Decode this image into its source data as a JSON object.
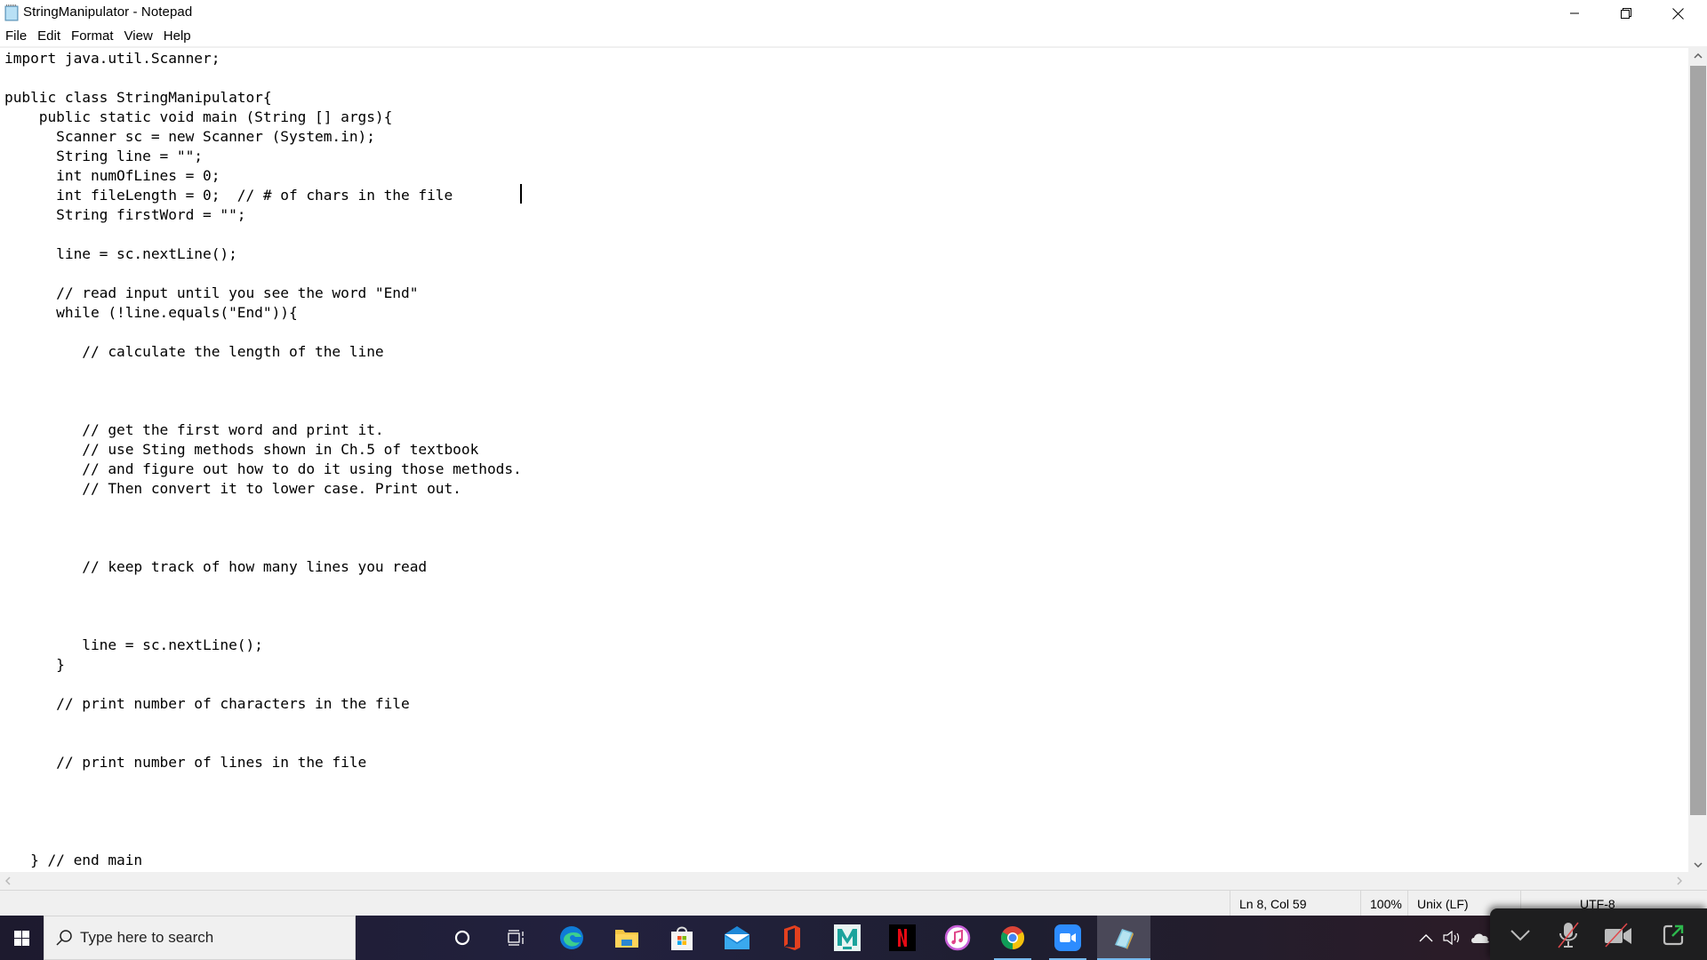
{
  "window": {
    "title": "StringManipulator - Notepad",
    "app_icon": "notepad-icon",
    "controls": {
      "minimize": "minimize-icon",
      "maximize": "restore-icon",
      "close": "close-icon"
    }
  },
  "menu": {
    "items": [
      {
        "label": "File"
      },
      {
        "label": "Edit"
      },
      {
        "label": "Format"
      },
      {
        "label": "View"
      },
      {
        "label": "Help"
      }
    ]
  },
  "editor": {
    "lines": [
      "import java.util.Scanner;",
      "",
      "public class StringManipulator{",
      "    public static void main (String [] args){",
      "      Scanner sc = new Scanner (System.in);",
      "      String line = \"\";",
      "      int numOfLines = 0;",
      "      int fileLength = 0;  // # of chars in the file      ",
      "      String firstWord = \"\";",
      "",
      "      line = sc.nextLine();",
      "",
      "      // read input until you see the word \"End\"",
      "      while (!line.equals(\"End\")){",
      "",
      "         // calculate the length of the line",
      "",
      "",
      "",
      "         // get the first word and print it.",
      "         // use Sting methods shown in Ch.5 of textbook",
      "         // and figure out how to do it using those methods.",
      "         // Then convert it to lower case. Print out.",
      "",
      "",
      "",
      "         // keep track of how many lines you read",
      "",
      "",
      "",
      "         line = sc.nextLine();",
      "      }",
      "",
      "      // print number of characters in the file",
      "",
      "",
      "      // print number of lines in the file",
      "",
      "",
      "",
      "",
      "   } // end main"
    ]
  },
  "status": {
    "position": "Ln 8, Col 59",
    "zoom": "100%",
    "line_ending": "Unix (LF)",
    "encoding": "UTF-8"
  },
  "taskbar": {
    "search_placeholder": "Type here to search",
    "apps": [
      {
        "name": "cortana",
        "icon": "cortana-icon"
      },
      {
        "name": "task-view",
        "icon": "task-view-icon"
      },
      {
        "name": "edge",
        "icon": "edge-icon"
      },
      {
        "name": "file-explorer",
        "icon": "folder-icon"
      },
      {
        "name": "microsoft-store",
        "icon": "store-icon"
      },
      {
        "name": "mail",
        "icon": "mail-icon"
      },
      {
        "name": "office",
        "icon": "office-icon"
      },
      {
        "name": "maya",
        "icon": "maya-icon"
      },
      {
        "name": "netflix",
        "icon": "netflix-icon"
      },
      {
        "name": "itunes",
        "icon": "itunes-icon"
      },
      {
        "name": "chrome",
        "icon": "chrome-icon",
        "running": true
      },
      {
        "name": "zoom",
        "icon": "zoom-icon",
        "running": true
      },
      {
        "name": "notepad",
        "icon": "notepad-icon",
        "running": true,
        "focused": true
      }
    ],
    "tray": [
      "chevron-up-icon",
      "volume-icon",
      "onedrive-icon"
    ]
  },
  "zoom_overlay": {
    "buttons": [
      "collapse-chevron-icon",
      "mic-muted-icon",
      "video-off-icon",
      "share-screen-icon"
    ],
    "colors": {
      "muted_slash": "#e0484b",
      "share": "#2db84d"
    }
  },
  "colors": {
    "scroll_thumb": "#a5a5a5",
    "chrome_bg": "#f0f0f0",
    "taskbar_active": "#76b9ed"
  }
}
